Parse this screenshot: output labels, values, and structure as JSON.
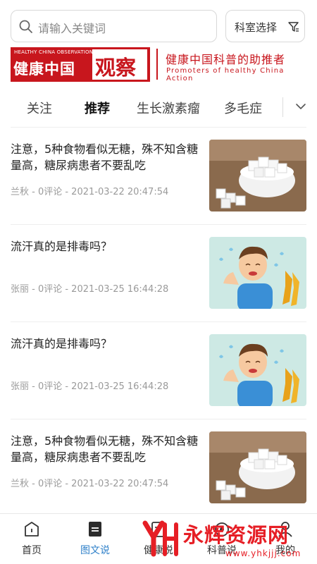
{
  "search": {
    "placeholder": "请输入关键词",
    "dept_label": "科室选择"
  },
  "banner": {
    "logo_sub": "HEALTHY CHINA OBSERVATION",
    "logo_main": "健康中国",
    "logo_char": "观察",
    "slogan": "健康中国科普的助推者",
    "slogan_en": "Promoters of healthy China Action"
  },
  "tabs": [
    {
      "label": "关注"
    },
    {
      "label": "推荐",
      "active": true
    },
    {
      "label": "生长激素瘤"
    },
    {
      "label": "多毛症"
    }
  ],
  "articles": [
    {
      "title": "注意，5种食物看似无糖，殊不知含糖量高，糖尿病患者不要乱吃",
      "meta": "兰秋 - 0评论 - 2021-03-22 20:47:54",
      "image": "sugar-cubes"
    },
    {
      "title": "流汗真的是排毒吗？",
      "meta": "张丽 - 0评论 - 2021-03-25 16:44:28",
      "image": "sweating-boy"
    },
    {
      "title": "流汗真的是排毒吗？",
      "meta": "张丽 - 0评论 - 2021-03-25 16:44:28",
      "image": "sweating-boy"
    },
    {
      "title": "注意，5种食物看似无糖，殊不知含糖量高，糖尿病患者不要乱吃",
      "meta": "兰秋 - 0评论 - 2021-03-22 20:47:54",
      "image": "sugar-cubes"
    }
  ],
  "bottom_nav": [
    {
      "label": "首页",
      "icon": "home-icon"
    },
    {
      "label": "图文说",
      "icon": "article-icon",
      "active": true
    },
    {
      "label": "健康说",
      "icon": "health-icon"
    },
    {
      "label": "科普说",
      "icon": "science-icon"
    },
    {
      "label": "我的",
      "icon": "profile-icon"
    }
  ],
  "watermark": {
    "text": "永辉资源网",
    "url": "www.yhkjjj.com"
  },
  "colors": {
    "brand_red": "#c8161d",
    "active_blue": "#2f80c9",
    "watermark_red": "#e61e25"
  }
}
